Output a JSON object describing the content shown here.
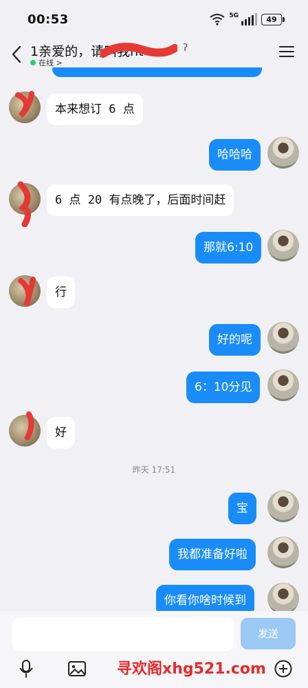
{
  "status": {
    "time": "00:53",
    "network": "5G",
    "battery": "49"
  },
  "header": {
    "title": "1亲爱的，请叫我ht",
    "status": "在线 >"
  },
  "messages": [
    {
      "side": "left",
      "text": "本来想订 6 点"
    },
    {
      "side": "right",
      "text": "哈哈哈"
    },
    {
      "side": "left",
      "text": "6 点 20 有点晚了，后面时间赶"
    },
    {
      "side": "right",
      "text": "那就6:10"
    },
    {
      "side": "left",
      "text": "行"
    },
    {
      "side": "right",
      "text": "好的呢"
    },
    {
      "side": "right",
      "text": "6：10分见"
    },
    {
      "side": "left",
      "text": "好"
    },
    {
      "side": "right",
      "text": "宝"
    },
    {
      "side": "right",
      "text": "我都准备好啦"
    },
    {
      "side": "right",
      "text": "你看你啥时候到"
    }
  ],
  "timestamp": "昨天 17:51",
  "input": {
    "send_label": "发送"
  },
  "toolbar": [
    "mic-icon",
    "image-icon",
    "plus-icon"
  ],
  "watermark": "寻欢阁xhg521.com",
  "colors": {
    "bubble_right": "#1a8cf7",
    "bubble_left": "#ffffff",
    "scribble": "#e53935",
    "send_disabled": "#9cc9f4"
  }
}
